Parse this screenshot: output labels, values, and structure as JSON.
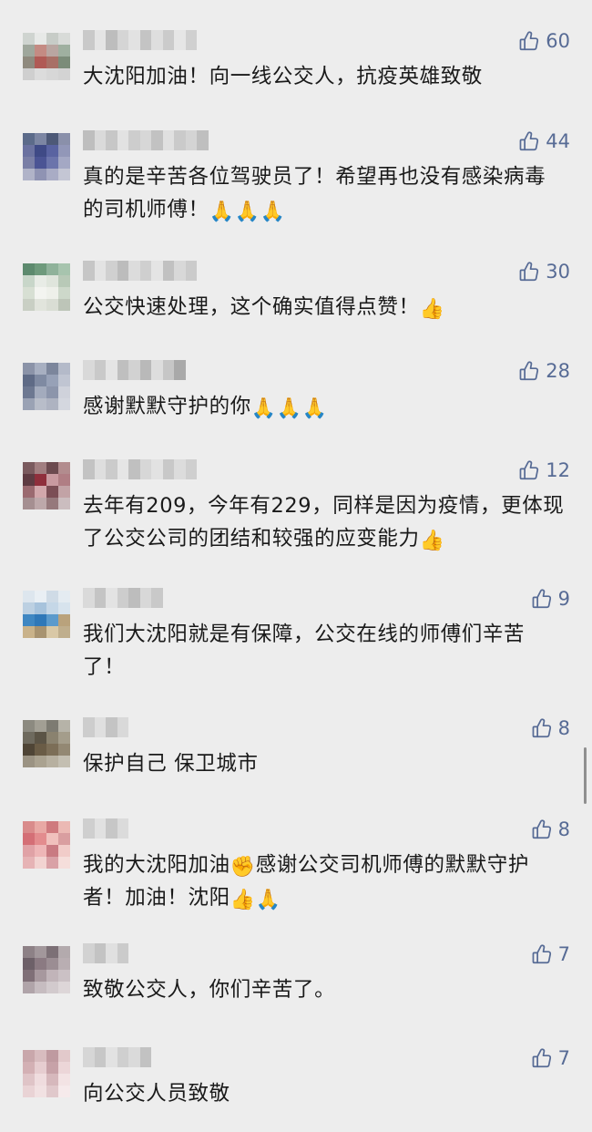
{
  "comments": [
    {
      "likes": "60",
      "text": "大沈阳加油！向一线公交人，抗疫英雄致敬",
      "avatar": [
        "#cfd4d0",
        "#e7e9e7",
        "#c7ccc7",
        "#d8dbd8",
        "#9fa79c",
        "#c48b83",
        "#b9a6a1",
        "#9fb0a0",
        "#8f8a7e",
        "#b05a55",
        "#a87066",
        "#7b8c79",
        "#cfcfcf",
        "#dcdcdc",
        "#d7d7d7",
        "#d3d3d3"
      ],
      "name": [
        "#c9c9c9",
        "#e4e4e4",
        "#bdbdbd",
        "#d5d5d5",
        "#e2e2e2",
        "#c4c4c4",
        "#dedede",
        "#cbcbcb",
        "#e6e6e6",
        "#d0d0d0"
      ]
    },
    {
      "likes": "44",
      "text": "真的是辛苦各位驾驶员了！希望再也没有感染病毒的司机师傅！",
      "emojis": [
        "🙏",
        "🙏",
        "🙏"
      ],
      "avatar": [
        "#5c6b8a",
        "#7c86a3",
        "#4d5977",
        "#8a90aa",
        "#6b72a0",
        "#3f4a86",
        "#5963a1",
        "#9297b8",
        "#7a7fa6",
        "#4b5494",
        "#6b74ab",
        "#a4a8c4",
        "#b0b3c8",
        "#8f93b3",
        "#a9acc5",
        "#c4c6d4"
      ],
      "name": [
        "#bebebe",
        "#dadada",
        "#c7c7c7",
        "#e2e2e2",
        "#cdcdcd",
        "#d7d7d7",
        "#c2c2c2",
        "#e0e0e0",
        "#cacaca",
        "#d4d4d4",
        "#bfbfbf"
      ]
    },
    {
      "likes": "30",
      "text": "公交快速处理，这个确实值得点赞！",
      "emojis": [
        "👍"
      ],
      "avatar": [
        "#5d8a6e",
        "#6e9a7c",
        "#8fb29a",
        "#a7c4ae",
        "#c8d6c9",
        "#e8ece6",
        "#dfe5dc",
        "#b8c9b7",
        "#d7dfd3",
        "#f3f4f0",
        "#eef0ea",
        "#cdd8ca",
        "#c9cfc4",
        "#e1e4dc",
        "#d9ddd4",
        "#bdc5b8"
      ],
      "name": [
        "#c6c6c6",
        "#e3e3e3",
        "#d0d0d0",
        "#bcbcbc",
        "#dcdcdc",
        "#cfcfcf",
        "#e4e4e4",
        "#c1c1c1",
        "#d8d8d8",
        "#cbcbcb"
      ]
    },
    {
      "likes": "28",
      "text": "感谢默默守护的你",
      "emojis": [
        "🙏",
        "🙏",
        "🙏"
      ],
      "avatar": [
        "#8b93a8",
        "#a7afc1",
        "#7c869c",
        "#b4bac9",
        "#5f6b86",
        "#7f8aa2",
        "#97a1b7",
        "#c0c5d2",
        "#6d7891",
        "#a3abbd",
        "#8c95ab",
        "#cfd2db",
        "#9aa2b4",
        "#b8bdc9",
        "#aeb3c1",
        "#d4d7df"
      ],
      "name": [
        "#d9d9d9",
        "#c9c9c9",
        "#e4e4e4",
        "#bfbfbf",
        "#d2d2d2",
        "#b9b9b9",
        "#dddddd",
        "#c6c6c6",
        "#a9a9a9"
      ]
    },
    {
      "likes": "12",
      "text": "去年有209，今年有229，同样是因为疫情，更体现了公交公司的团结和较强的应变能力",
      "emojis": [
        "👍"
      ],
      "avatar": [
        "#7a5a5e",
        "#a17e80",
        "#6c4a4f",
        "#b28c8e",
        "#5e3b42",
        "#8f2f3c",
        "#c99aa0",
        "#b07e84",
        "#9b6a70",
        "#d2a7ab",
        "#7b4e55",
        "#c2a3a6",
        "#a58f91",
        "#bda8aa",
        "#96797c",
        "#cbbdbf"
      ],
      "name": [
        "#c3c3c3",
        "#dedede",
        "#cbcbcb",
        "#e5e5e5",
        "#c0c0c0",
        "#d7d7d7",
        "#e2e2e2",
        "#c8c8c8",
        "#dcdcdc",
        "#cfcfcf"
      ]
    },
    {
      "likes": "9",
      "text": "我们大沈阳就是有保障，公交在线的师傅们辛苦了！",
      "avatar": [
        "#dde6ee",
        "#e9eff4",
        "#cfdbe6",
        "#e4ebf1",
        "#bcd0e2",
        "#a7c3dc",
        "#c5d7e7",
        "#d7e3ed",
        "#3f87c2",
        "#2f78b8",
        "#5b9acc",
        "#b9a27c",
        "#c9b28a",
        "#a89370",
        "#d9c8a6",
        "#bfae8d"
      ],
      "name": [
        "#dadada",
        "#c4c4c4",
        "#e3e3e3",
        "#cdcdcd",
        "#bdbdbd",
        "#d8d8d8",
        "#c9c9c9"
      ]
    },
    {
      "likes": "8",
      "text": "保护自己 保卫城市",
      "avatar": [
        "#8c8a80",
        "#a29f94",
        "#7d7b72",
        "#b6b3a8",
        "#6e6a5e",
        "#5b5446",
        "#8a826f",
        "#a49d8b",
        "#4f4536",
        "#6a5c46",
        "#7c6e57",
        "#938873",
        "#9b9383",
        "#aaa290",
        "#b7b0a0",
        "#c4bfb2"
      ],
      "name": [
        "#cdcdcd",
        "#dfdfdf",
        "#c4c4c4",
        "#d9d9d9"
      ]
    },
    {
      "likes": "8",
      "text": "我的大沈阳加油",
      "text2": "感谢公交司机师傅的默默守护者！加油！沈阳",
      "emojis": [
        "✊"
      ],
      "emojis2": [
        "👍",
        "🙏"
      ],
      "avatar": [
        "#d98b8b",
        "#e8a8a4",
        "#cf7a7e",
        "#ebb9b4",
        "#d46f76",
        "#e38c8e",
        "#f0c1bd",
        "#d99ea0",
        "#e0a2a6",
        "#eeb6b7",
        "#c97b82",
        "#f1ccc9",
        "#e6b3b5",
        "#f2d3d1",
        "#d9a1a6",
        "#f5dedb"
      ],
      "name": [
        "#cfcfcf",
        "#e1e1e1",
        "#c7c7c7",
        "#dbdbdb"
      ]
    },
    {
      "likes": "7",
      "text": "致敬公交人，你们辛苦了。",
      "avatar": [
        "#8d8186",
        "#a2979b",
        "#7c7076",
        "#b3aaad",
        "#6d6068",
        "#8b7a82",
        "#9b8d93",
        "#b9aeb2",
        "#7f6f77",
        "#a7989e",
        "#c1b4b9",
        "#cbc1c5",
        "#b0a4a9",
        "#c6bcc0",
        "#d2cacd",
        "#ddd6d8"
      ],
      "name": [
        "#d2d2d2",
        "#c3c3c3",
        "#e0e0e0",
        "#cbcbcb"
      ]
    },
    {
      "likes": "7",
      "text": "向公交人员致敬",
      "avatar": [
        "#c9a7ab",
        "#d8bcbf",
        "#bf9aa0",
        "#e2c9cb",
        "#d3b0b4",
        "#e6cdd0",
        "#c7a2a8",
        "#ecd6d8",
        "#dfc4c7",
        "#efdcde",
        "#d6b8bc",
        "#f3e3e4",
        "#e9d3d5",
        "#f1e1e2",
        "#e0c8cb",
        "#f6eaeb"
      ],
      "name": [
        "#d6d6d6",
        "#c7c7c7",
        "#e2e2e2",
        "#cfcfcf",
        "#dadada",
        "#c2c2c2"
      ]
    }
  ]
}
